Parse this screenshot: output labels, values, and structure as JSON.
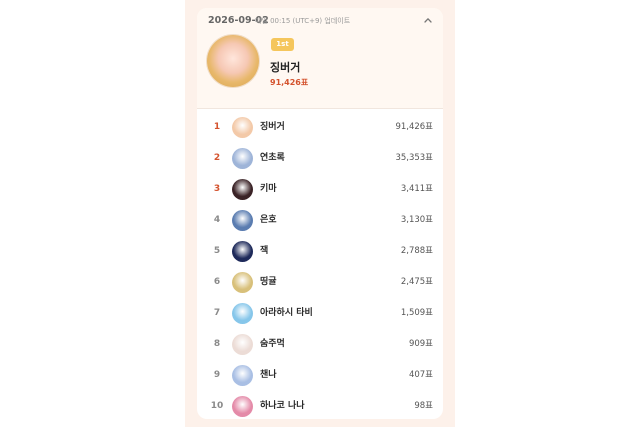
{
  "header": {
    "date": "2026-09-02",
    "update_text": "매일 00:15 (UTC+9) 업데이트",
    "collapse_icon": "chevron-up-icon"
  },
  "winner": {
    "badge": "1st",
    "name": "징버거",
    "votes": "91,426표"
  },
  "ranking": [
    {
      "rank": "1",
      "name": "징버거",
      "votes": "91,426표",
      "avatar_color": "#f3c9a8"
    },
    {
      "rank": "2",
      "name": "연초록",
      "votes": "35,353표",
      "avatar_color": "#9eb4d8"
    },
    {
      "rank": "3",
      "name": "키마",
      "votes": "3,411표",
      "avatar_color": "#3a2226"
    },
    {
      "rank": "4",
      "name": "은호",
      "votes": "3,130표",
      "avatar_color": "#5a7cb0"
    },
    {
      "rank": "5",
      "name": "잭",
      "votes": "2,788표",
      "avatar_color": "#1e2a5a"
    },
    {
      "rank": "6",
      "name": "띵귤",
      "votes": "2,475표",
      "avatar_color": "#d8c07a"
    },
    {
      "rank": "7",
      "name": "아라하시 타비",
      "votes": "1,509표",
      "avatar_color": "#86c6ea"
    },
    {
      "rank": "8",
      "name": "숨주먹",
      "votes": "909표",
      "avatar_color": "#ecdcd6"
    },
    {
      "rank": "9",
      "name": "챈나",
      "votes": "407표",
      "avatar_color": "#a9bfe4"
    },
    {
      "rank": "10",
      "name": "하나코 나나",
      "votes": "98표",
      "avatar_color": "#e48aa8"
    }
  ],
  "colors": {
    "accent": "#d4532e",
    "badge": "#f5c65c",
    "panel_bg": "#fdf1ea"
  }
}
